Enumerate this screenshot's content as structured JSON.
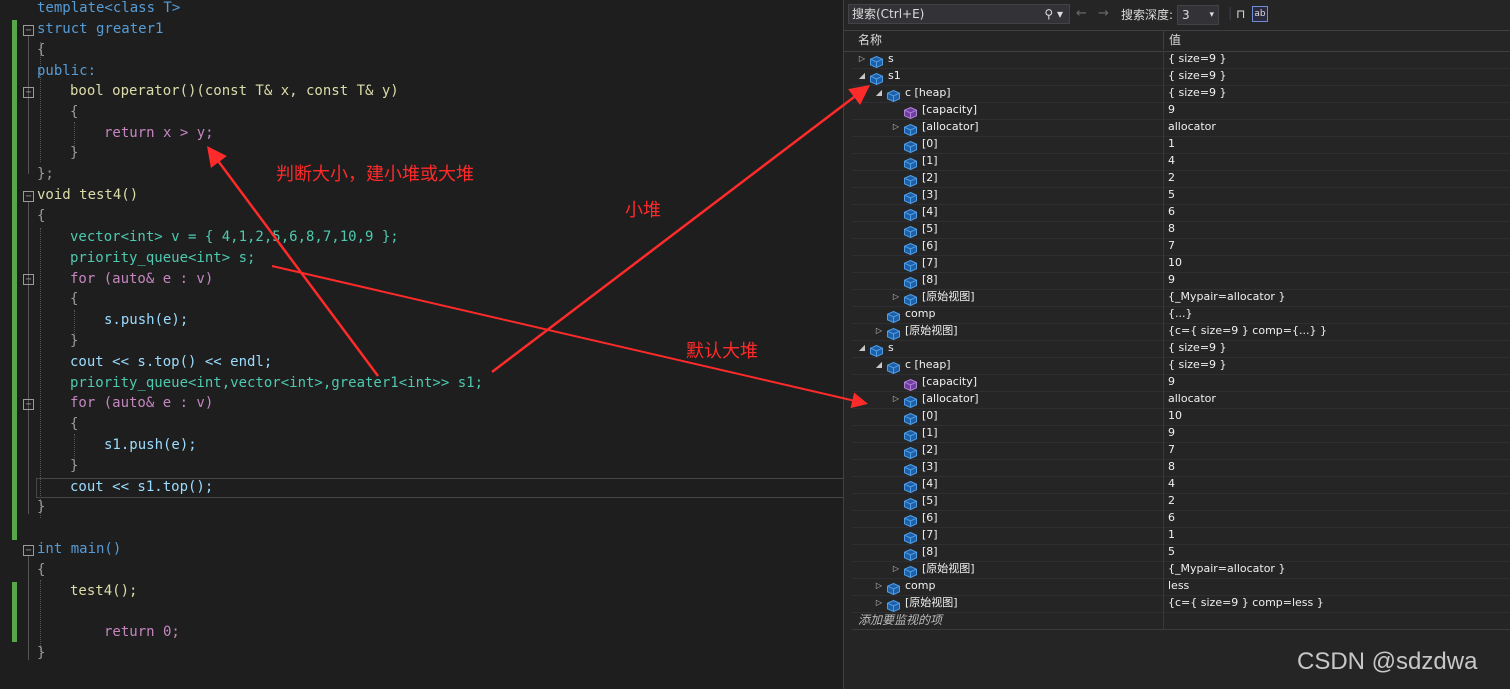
{
  "code": {
    "line1": "template<class T>",
    "line2": "struct greater1",
    "line3": "{",
    "line4": "public:",
    "line5": "bool operator()(const T& x, const T& y)",
    "line6": "{",
    "line7": "return x > y;",
    "line8": "}",
    "line9": "};",
    "line10": "void test4()",
    "line11": "{",
    "line12": "vector<int> v = { 4,1,2,5,6,8,7,10,9 };",
    "line13": "priority_queue<int> s;",
    "line14": "for (auto& e : v)",
    "line15": "{",
    "line16": "s.push(e);",
    "line17": "}",
    "line18": "cout << s.top() << endl;",
    "line19": "priority_queue<int,vector<int>,greater1<int>> s1;",
    "line20": "for (auto& e : v)",
    "line21": "{",
    "line22": "s1.push(e);",
    "line23": "}",
    "line24": "cout << s1.top();",
    "line25": "}",
    "line26": "int main()",
    "line27": "{",
    "line28": "test4();",
    "line29": "return 0;",
    "line30": "}"
  },
  "annotations": {
    "compare": "判断大小，建小堆或大堆",
    "min_heap": "小堆",
    "default_heap": "默认大堆",
    "color": "#ff2a2a"
  },
  "watch": {
    "search_placeholder": "搜索(Ctrl+E)",
    "depth_label": "搜索深度:",
    "depth_value": "3",
    "col_name": "名称",
    "col_value": "值",
    "add_item": "添加要监视的项",
    "rows": [
      {
        "name": "s",
        "value": "{ size=9 }",
        "expander": "collapsed",
        "icon": "struct-icon"
      },
      {
        "name": "s1",
        "value": "{ size=9 }",
        "expander": "expanded",
        "icon": "struct-icon"
      },
      {
        "name": "c [heap]",
        "value": "{ size=9 }",
        "expander": "expanded",
        "icon": "struct-icon"
      },
      {
        "name": "[capacity]",
        "value": "9",
        "expander": "none",
        "icon": "property-icon"
      },
      {
        "name": "[allocator]",
        "value": "allocator",
        "expander": "collapsed",
        "icon": "struct-icon"
      },
      {
        "name": "[0]",
        "value": "1",
        "expander": "none",
        "icon": "struct-icon"
      },
      {
        "name": "[1]",
        "value": "4",
        "expander": "none",
        "icon": "struct-icon"
      },
      {
        "name": "[2]",
        "value": "2",
        "expander": "none",
        "icon": "struct-icon"
      },
      {
        "name": "[3]",
        "value": "5",
        "expander": "none",
        "icon": "struct-icon"
      },
      {
        "name": "[4]",
        "value": "6",
        "expander": "none",
        "icon": "struct-icon"
      },
      {
        "name": "[5]",
        "value": "8",
        "expander": "none",
        "icon": "struct-icon"
      },
      {
        "name": "[6]",
        "value": "7",
        "expander": "none",
        "icon": "struct-icon"
      },
      {
        "name": "[7]",
        "value": "10",
        "expander": "none",
        "icon": "struct-icon"
      },
      {
        "name": "[8]",
        "value": "9",
        "expander": "none",
        "icon": "struct-icon"
      },
      {
        "name": "[原始视图]",
        "value": "{_Mypair=allocator }",
        "expander": "collapsed",
        "icon": "struct-icon"
      },
      {
        "name": "comp",
        "value": "{...}",
        "expander": "none",
        "icon": "struct-icon"
      },
      {
        "name": "[原始视图]",
        "value": "{c={ size=9 } comp={...} }",
        "expander": "collapsed",
        "icon": "struct-icon"
      },
      {
        "name": "s",
        "value": "{ size=9 }",
        "expander": "expanded",
        "icon": "struct-icon"
      },
      {
        "name": "c [heap]",
        "value": "{ size=9 }",
        "expander": "expanded",
        "icon": "struct-icon"
      },
      {
        "name": "[capacity]",
        "value": "9",
        "expander": "none",
        "icon": "property-icon"
      },
      {
        "name": "[allocator]",
        "value": "allocator",
        "expander": "collapsed",
        "icon": "struct-icon"
      },
      {
        "name": "[0]",
        "value": "10",
        "expander": "none",
        "icon": "struct-icon"
      },
      {
        "name": "[1]",
        "value": "9",
        "expander": "none",
        "icon": "struct-icon"
      },
      {
        "name": "[2]",
        "value": "7",
        "expander": "none",
        "icon": "struct-icon"
      },
      {
        "name": "[3]",
        "value": "8",
        "expander": "none",
        "icon": "struct-icon"
      },
      {
        "name": "[4]",
        "value": "4",
        "expander": "none",
        "icon": "struct-icon"
      },
      {
        "name": "[5]",
        "value": "2",
        "expander": "none",
        "icon": "struct-icon"
      },
      {
        "name": "[6]",
        "value": "6",
        "expander": "none",
        "icon": "struct-icon"
      },
      {
        "name": "[7]",
        "value": "1",
        "expander": "none",
        "icon": "struct-icon"
      },
      {
        "name": "[8]",
        "value": "5",
        "expander": "none",
        "icon": "struct-icon"
      },
      {
        "name": "[原始视图]",
        "value": "{_Mypair=allocator }",
        "expander": "collapsed",
        "icon": "struct-icon"
      },
      {
        "name": "comp",
        "value": "less",
        "expander": "collapsed",
        "icon": "struct-icon"
      },
      {
        "name": "[原始视图]",
        "value": "{c={ size=9 } comp=less }",
        "expander": "collapsed",
        "icon": "struct-icon"
      }
    ]
  },
  "watermark": "CSDN @sdzdwa"
}
